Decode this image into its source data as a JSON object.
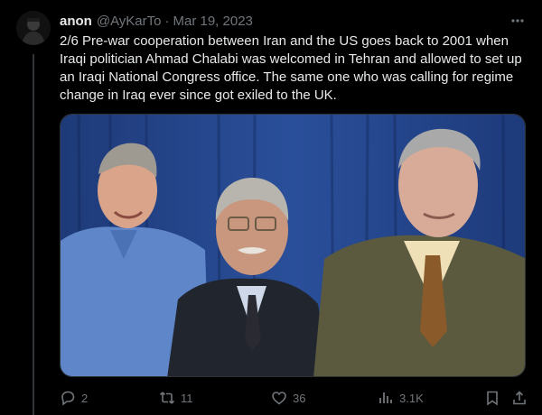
{
  "tweet": {
    "author_name": "anon",
    "handle": "@AyKarTo",
    "separator": "·",
    "date": "Mar 19, 2023",
    "text": "2/6 Pre-war cooperation between Iran and the US goes back to 2001 when Iraqi politician Ahmad Chalabi was welcomed in Tehran and allowed to set up an Iraqi National Congress office. The same one who was calling for regime change in Iraq ever since got exiled to the UK."
  },
  "stats": {
    "replies": "2",
    "retweets": "11",
    "likes": "36",
    "views": "3.1K"
  },
  "icons": {
    "more": "more-dots-icon",
    "reply": "reply-icon",
    "retweet": "retweet-icon",
    "like": "heart-icon",
    "views": "views-icon",
    "bookmark": "bookmark-icon",
    "share": "share-icon"
  },
  "colors": {
    "background": "#000000",
    "text_primary": "#e7e9ea",
    "text_secondary": "#71767b",
    "border": "#2f3336"
  }
}
